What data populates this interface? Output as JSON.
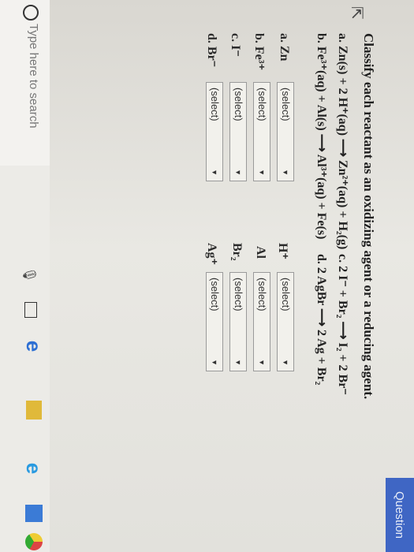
{
  "header": {
    "tab_label": "Question"
  },
  "question": {
    "prompt": "Classify each reactant as an oxidizing agent or a reducing agent.",
    "equations": {
      "a": "a. Zn(s) + 2 H⁺(aq) ⟶ Zn²⁺(aq) + H₂(g)",
      "b": "b. Fe³⁺(aq) + Al(s) ⟶ Al³⁺(aq) + Fe(s)",
      "c": "c. 2 I⁻ + Br₂ ⟶ I₂ + 2 Br⁻",
      "d": "d. 2 AgBr ⟶ 2 Ag + Br₂"
    },
    "rows": [
      {
        "left_label": "a. Zn",
        "left_value": "(select)",
        "right_label": "H⁺",
        "right_value": "(select)"
      },
      {
        "left_label": "b. Fe³⁺",
        "left_value": "(select)",
        "right_label": "Al",
        "right_value": "(select)"
      },
      {
        "left_label": "c. I⁻",
        "left_value": "(select)",
        "right_label": "Br₂",
        "right_value": "(select)"
      },
      {
        "left_label": "d. Br⁻",
        "left_value": "(select)",
        "right_label": "Ag⁺",
        "right_value": "(select)"
      }
    ],
    "dropdown_arrow": "▼"
  },
  "taskbar": {
    "search_placeholder": "Type here to search",
    "icons": [
      "search-icon",
      "microphone-icon",
      "task-view-icon",
      "edge-icon",
      "file-explorer-icon",
      "internet-explorer-icon",
      "store-icon",
      "chrome-icon"
    ]
  },
  "colors": {
    "accent": "#3f66c4",
    "background": "#e9e8e3"
  }
}
